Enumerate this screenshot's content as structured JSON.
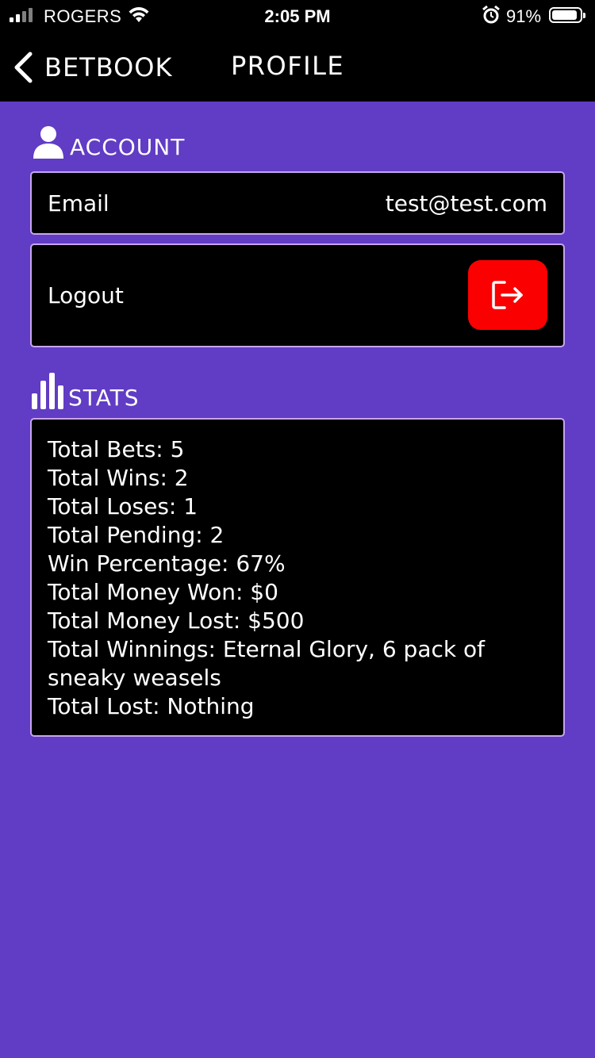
{
  "status_bar": {
    "carrier": "ROGERS",
    "time": "2:05 PM",
    "battery_percent": "91%",
    "battery_level": 0.91,
    "icons": [
      "signal-icon",
      "wifi-icon",
      "alarm-icon",
      "battery-icon"
    ]
  },
  "nav": {
    "back_label": "BETBOOK",
    "title": "PROFILE",
    "back_icon": "chevron-left-icon"
  },
  "account": {
    "header": "ACCOUNT",
    "header_icon": "user-icon",
    "email_label": "Email",
    "email_value": "test@test.com",
    "logout_label": "Logout",
    "logout_icon": "logout-icon"
  },
  "stats": {
    "header": "STATS",
    "header_icon": "bar-chart-icon",
    "lines": [
      "Total Bets: 5",
      "Total Wins: 2",
      "Total Loses: 1",
      "Total Pending: 2",
      "Win Percentage: 67%",
      "Total Money Won: $0",
      "Total Money Lost: $500",
      "Total Winnings: Eternal Glory, 6 pack of sneaky weasels",
      "Total Lost: Nothing"
    ]
  },
  "colors": {
    "background": "#613cc4",
    "card": "#000000",
    "card_border": "#c7a6f0",
    "logout_button": "#fb0000",
    "text": "#ffffff"
  }
}
